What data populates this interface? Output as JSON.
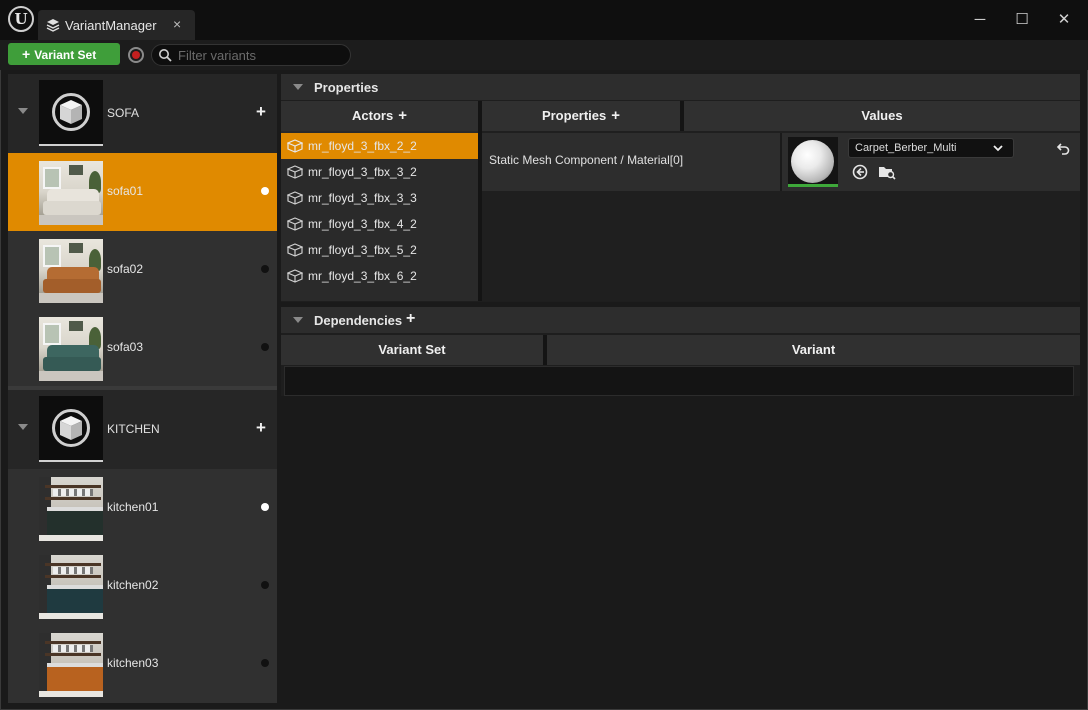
{
  "window": {
    "tab_title": "VariantManager",
    "close_symbol": "×",
    "minimize_symbol": "─",
    "maximize_symbol": "☐",
    "window_close_symbol": "✕",
    "logo_glyph": "U"
  },
  "toolbar": {
    "variant_set_label": "Variant Set",
    "plus_symbol": "+",
    "filter_placeholder": "Filter variants"
  },
  "variant_sets": [
    {
      "name": "SOFA",
      "variants": [
        {
          "name": "sofa01",
          "active": true
        },
        {
          "name": "sofa02",
          "active": false
        },
        {
          "name": "sofa03",
          "active": false
        }
      ]
    },
    {
      "name": "KITCHEN",
      "variants": [
        {
          "name": "kitchen01",
          "active": true
        },
        {
          "name": "kitchen02",
          "active": false
        },
        {
          "name": "kitchen03",
          "active": false
        }
      ]
    }
  ],
  "properties_section": {
    "title": "Properties",
    "actors_header": "Actors",
    "properties_header": "Properties",
    "values_header": "Values",
    "actors": [
      "mr_floyd_3_fbx_2_2",
      "mr_floyd_3_fbx_3_2",
      "mr_floyd_3_fbx_3_3",
      "mr_floyd_3_fbx_4_2",
      "mr_floyd_3_fbx_5_2",
      "mr_floyd_3_fbx_6_2"
    ],
    "property": {
      "name": "Static Mesh Component / Material[0]",
      "value": "Carpet_Berber_Multi"
    }
  },
  "dependencies_section": {
    "title": "Dependencies",
    "variant_set_header": "Variant Set",
    "variant_header": "Variant"
  },
  "colors": {
    "accent_orange": "#e08a00",
    "button_green": "#3f9e3a",
    "record_red": "#c21f1f"
  }
}
